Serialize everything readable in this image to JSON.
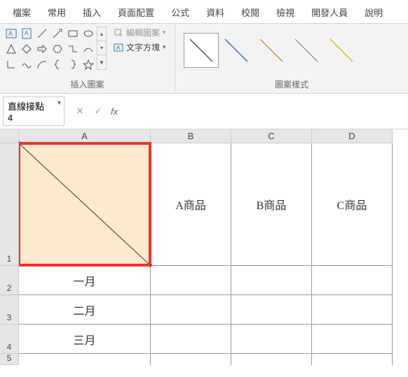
{
  "ribbon": {
    "tabs": [
      "檔案",
      "常用",
      "插入",
      "頁面配置",
      "公式",
      "資料",
      "校閱",
      "檢視",
      "開發人員",
      "說明"
    ],
    "shapes_group": {
      "label": "插入圖案",
      "edit_shape": "編輯圖案",
      "text_box": "文字方塊"
    },
    "styles_group": {
      "label": "圖案樣式"
    }
  },
  "namebox": {
    "value": "直線接點 4"
  },
  "fx": {
    "cancel": "✕",
    "confirm": "✓",
    "label": "fx"
  },
  "columns": [
    "A",
    "B",
    "C",
    "D"
  ],
  "rows": [
    "1",
    "2",
    "3",
    "4",
    "5"
  ],
  "cells": {
    "B1": "A商品",
    "C1": "B商品",
    "D1": "C商品",
    "A2": "一月",
    "A3": "二月",
    "A4": "三月"
  },
  "line_colors": [
    "#555",
    "#3a6fb7",
    "#d98b3a",
    "#9a9a9a",
    "#e6b800"
  ]
}
